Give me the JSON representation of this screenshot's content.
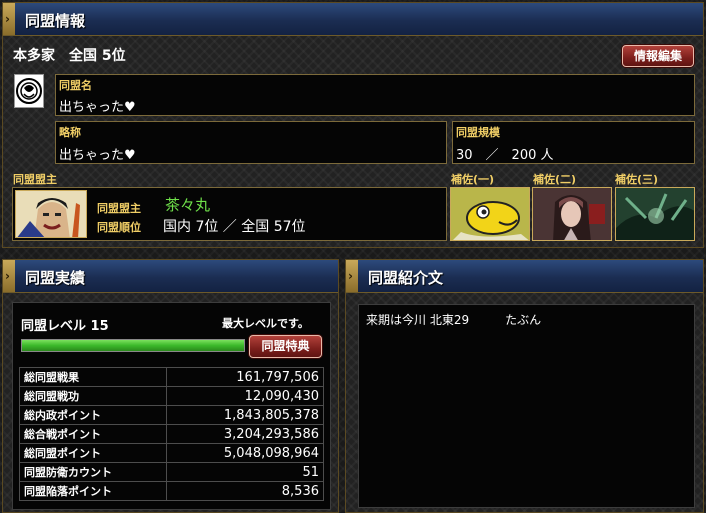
{
  "alliance_info": {
    "section_title": "同盟情報",
    "house_rank": "本多家　全国 5位",
    "edit_button": "情報編集",
    "name_label": "同盟名",
    "name_value": "出ちゃった♥",
    "abbr_label": "略称",
    "abbr_value": "出ちゃった♥",
    "scale_label": "同盟規模",
    "scale_value": "30　／　200 人",
    "leader_section": "同盟盟主",
    "leader_label": "同盟盟主",
    "leader_name": "茶々丸",
    "rank_label": "同盟順位",
    "rank_value": "国内 7位 ／ 全国 57位",
    "assistants": [
      "補佐(一)",
      "補佐(二)",
      "補佐(三)"
    ]
  },
  "achievements": {
    "section_title": "同盟実績",
    "level_text": "同盟レベル 15",
    "max_level_text": "最大レベルです。",
    "level_progress": 1.0,
    "perks_button": "同盟特典",
    "rows": [
      {
        "label": "総同盟戦果",
        "value": "161,797,506"
      },
      {
        "label": "総同盟戦功",
        "value": "12,090,430"
      },
      {
        "label": "総内政ポイント",
        "value": "1,843,805,378"
      },
      {
        "label": "総合戦ポイント",
        "value": "3,204,293,586"
      },
      {
        "label": "総同盟ポイント",
        "value": "5,048,098,964"
      },
      {
        "label": "同盟防衛カウント",
        "value": "51"
      },
      {
        "label": "同盟陥落ポイント",
        "value": "8,536"
      }
    ]
  },
  "introduction": {
    "section_title": "同盟紹介文",
    "text": "来期は今川 北東29　　　たぶん"
  },
  "colors": {
    "header_blue": "#1b2d52",
    "gold_label": "#f0ce66",
    "leader_green": "#6fe04a",
    "progress_green": "#3bb82a",
    "button_red": "#7d1f1c"
  }
}
